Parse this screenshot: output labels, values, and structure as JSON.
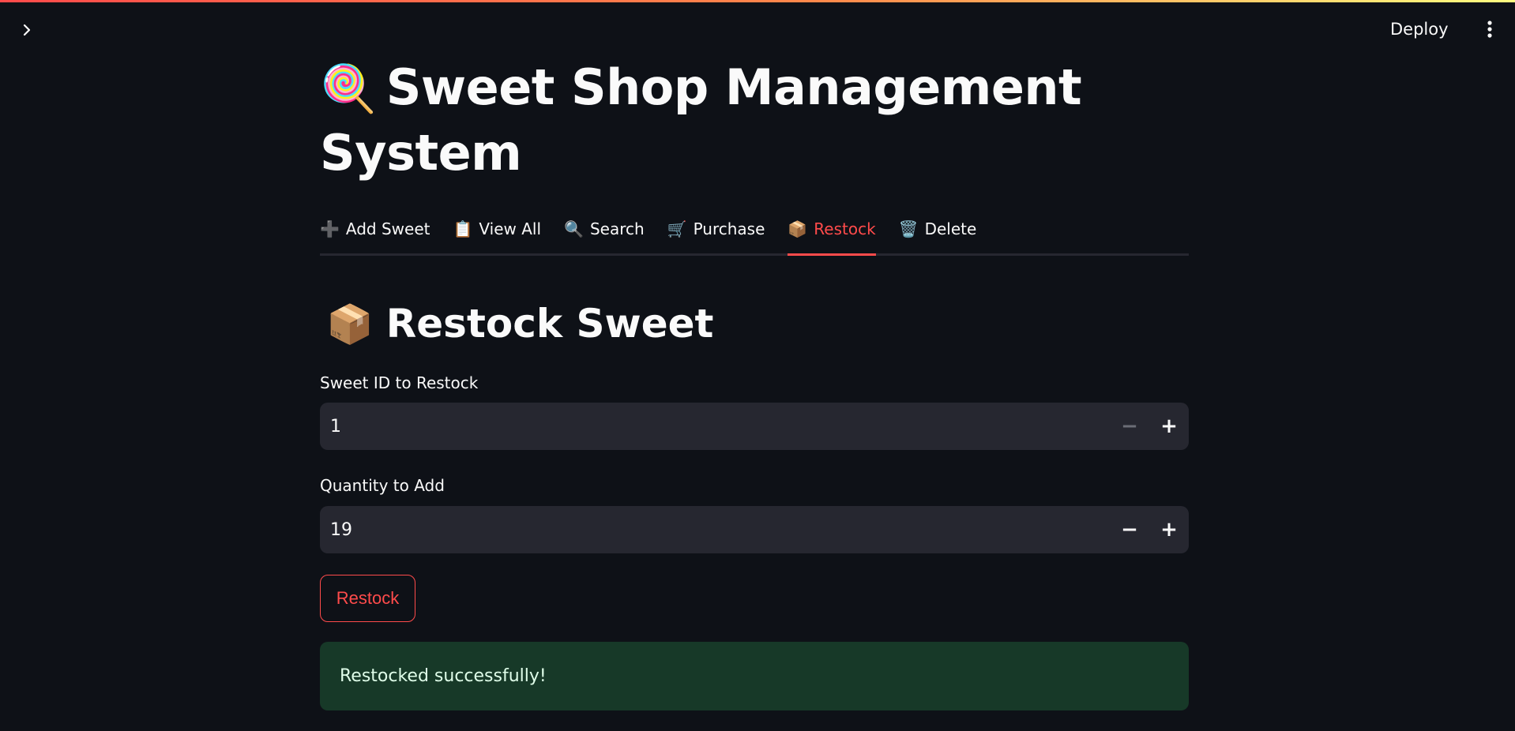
{
  "header": {
    "expand_icon": "chevron-right-icon",
    "deploy_label": "Deploy",
    "menu_icon": "vertical-ellipsis-icon"
  },
  "title": {
    "emoji": "🍭",
    "text": "Sweet Shop Management System"
  },
  "tabs": [
    {
      "icon": "➕",
      "label": "Add Sweet",
      "active": false
    },
    {
      "icon": "📋",
      "label": "View All",
      "active": false
    },
    {
      "icon": "🔍",
      "label": "Search",
      "active": false
    },
    {
      "icon": "🛒",
      "label": "Purchase",
      "active": false
    },
    {
      "icon": "📦",
      "label": "Restock",
      "active": true
    },
    {
      "icon": "🗑️",
      "label": "Delete",
      "active": false
    }
  ],
  "section": {
    "emoji": "📦",
    "title": "Restock Sweet"
  },
  "form": {
    "sweet_id": {
      "label": "Sweet ID to Restock",
      "value": "1",
      "minus": "−",
      "plus": "+"
    },
    "quantity": {
      "label": "Quantity to Add",
      "value": "19",
      "minus": "−",
      "plus": "+"
    },
    "submit_label": "Restock"
  },
  "alert": {
    "message": "Restocked successfully!"
  },
  "colors": {
    "background": "#0e1117",
    "accent": "#ff4b4b",
    "input_bg": "#262730",
    "success_bg": "#173928"
  }
}
